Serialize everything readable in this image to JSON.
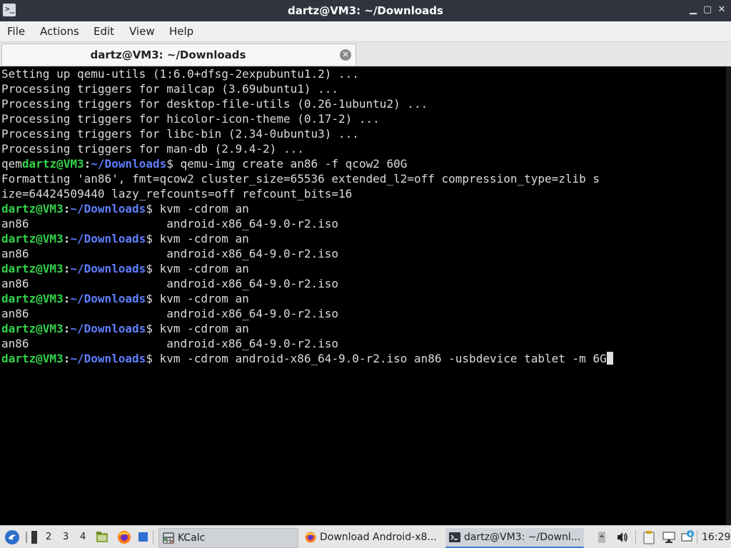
{
  "window": {
    "title": "dartz@VM3: ~/Downloads",
    "icon_glyph": ">_",
    "minimize_glyph": "▁",
    "maximize_glyph": "▢",
    "close_glyph": "✕"
  },
  "menu": {
    "file": "File",
    "actions": "Actions",
    "edit": "Edit",
    "view": "View",
    "help": "Help"
  },
  "tab": {
    "label": "dartz@VM3: ~/Downloads",
    "close_glyph": "✕"
  },
  "prompt": {
    "user": "dartz@VM3",
    "colon": ":",
    "path": "~/Downloads",
    "dollar": "$ "
  },
  "terminal": {
    "line1": "Setting up qemu-utils (1:6.0+dfsg-2expubuntu1.2) ...",
    "line2": "Processing triggers for mailcap (3.69ubuntu1) ...",
    "line3": "Processing triggers for desktop-file-utils (0.26-1ubuntu2) ...",
    "line4": "Processing triggers for hicolor-icon-theme (0.17-2) ...",
    "line5": "Processing triggers for libc-bin (2.34-0ubuntu3) ...",
    "line6": "Processing triggers for man-db (2.9.4-2) ...",
    "line7_prefix": "qem",
    "line7_cmd": "qemu-img create an86 -f qcow2 60G",
    "line8": "Formatting 'an86', fmt=qcow2 cluster_size=65536 extended_l2=off compression_type=zlib s",
    "line9": "ize=64424509440 lazy_refcounts=off refcount_bits=16",
    "cmd_partial": "kvm -cdrom an",
    "completion": "an86                    android-x86_64-9.0-r2.iso",
    "cmd_final": "kvm -cdrom android-x86_64-9.0-r2.iso an86 -usbdevice tablet -m 6G"
  },
  "taskbar": {
    "workspaces": [
      "2",
      "3",
      "4"
    ],
    "tasks": {
      "kcalc": "KCalc",
      "browser": "Download Android-x8...",
      "terminal": "dartz@VM3: ~/Downl..."
    },
    "clock": "16:29",
    "colors": {
      "active_task": "#d0d4da",
      "highlight": "#3d7cd4"
    }
  },
  "icons": {
    "start": "start-menu-icon",
    "files": "file-manager-icon",
    "firefox": "firefox-icon",
    "desktop": "show-desktop-icon",
    "volume": "volume-icon",
    "clipboard": "clipboard-icon",
    "network": "network-icon",
    "updates": "updates-icon"
  }
}
